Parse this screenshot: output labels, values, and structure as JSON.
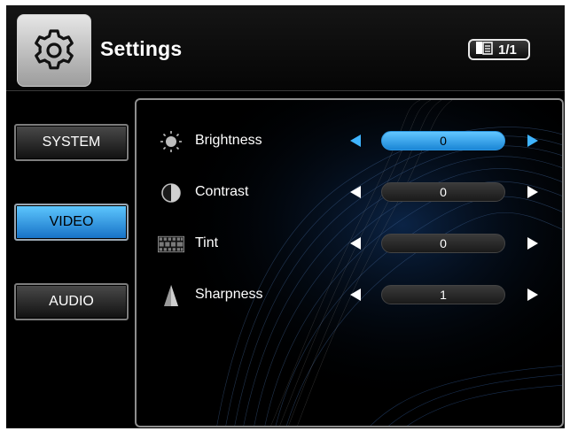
{
  "header": {
    "title": "Settings",
    "page_indicator": "1/1"
  },
  "tabs": [
    {
      "label": "SYSTEM",
      "active": false
    },
    {
      "label": "VIDEO",
      "active": true
    },
    {
      "label": "AUDIO",
      "active": false
    }
  ],
  "settings": [
    {
      "label": "Brightness",
      "value": "0",
      "icon": "brightness-icon",
      "selected": true
    },
    {
      "label": "Contrast",
      "value": "0",
      "icon": "contrast-icon",
      "selected": false
    },
    {
      "label": "Tint",
      "value": "0",
      "icon": "tint-icon",
      "selected": false
    },
    {
      "label": "Sharpness",
      "value": "1",
      "icon": "sharpness-icon",
      "selected": false
    }
  ],
  "colors": {
    "accent_blue": "#3fb4ff",
    "background": "#000000",
    "text": "#ffffff"
  }
}
